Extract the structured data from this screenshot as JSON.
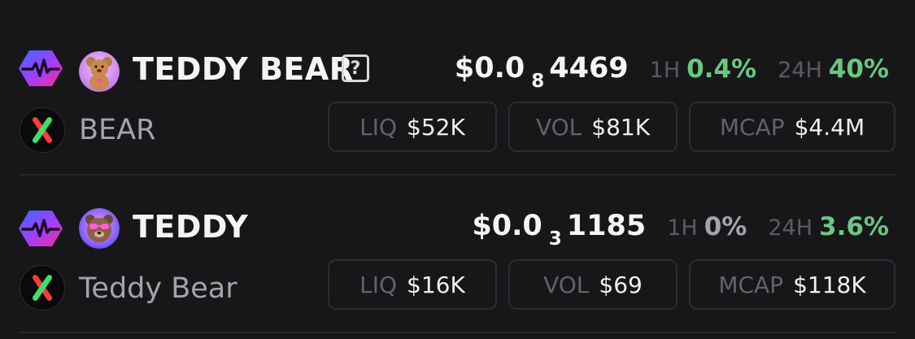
{
  "tokens": [
    {
      "name": "TEDDY BEAR",
      "has_help_icon": true,
      "help_glyph": "?",
      "symbol": "BEAR",
      "price": {
        "prefix": "$0.0",
        "zero_count": "8",
        "digits": "4469"
      },
      "change_1h": {
        "label": "1H",
        "value": "0.4%",
        "color": "#6ac781"
      },
      "change_24h": {
        "label": "24H",
        "value": "40%",
        "color": "#6ac781"
      },
      "stats": [
        {
          "label": "LIQ",
          "value": "$52K"
        },
        {
          "label": "VOL",
          "value": "$81K"
        },
        {
          "label": "MCAP",
          "value": "$4.4M"
        }
      ],
      "avatar_icon": "teddy-bear-avatar-icon",
      "chain_icon": "pulse-chain-icon",
      "dex_icon": "x-dex-icon"
    },
    {
      "name": "TEDDY",
      "has_help_icon": false,
      "symbol": "Teddy Bear",
      "price": {
        "prefix": "$0.0",
        "zero_count": "3",
        "digits": "1185"
      },
      "change_1h": {
        "label": "1H",
        "value": "0%",
        "color": "#a3a3aa"
      },
      "change_24h": {
        "label": "24H",
        "value": "3.6%",
        "color": "#6ac781"
      },
      "stats": [
        {
          "label": "LIQ",
          "value": "$16K"
        },
        {
          "label": "VOL",
          "value": "$69"
        },
        {
          "label": "MCAP",
          "value": "$118K"
        }
      ],
      "avatar_icon": "teddy-avatar-icon",
      "chain_icon": "pulse-chain-icon",
      "dex_icon": "x-dex-icon"
    }
  ],
  "colors": {
    "background": "#17171a",
    "positive": "#6ac781",
    "neutral": "#a3a3aa",
    "border": "#2b2b31"
  }
}
